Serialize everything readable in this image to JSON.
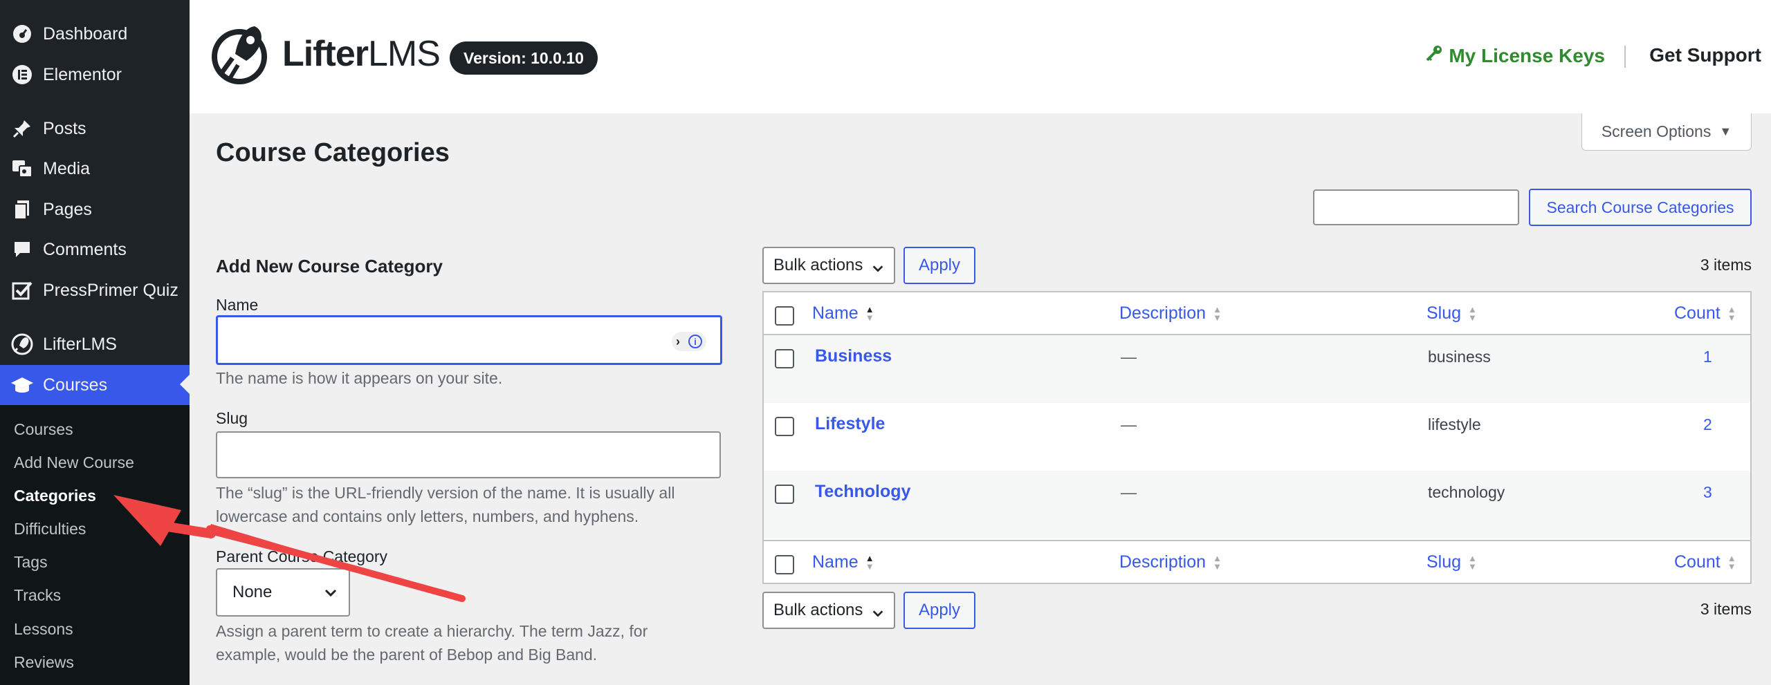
{
  "sidebar": {
    "items": [
      {
        "label": "Dashboard",
        "icon": "dashboard-icon"
      },
      {
        "label": "Elementor",
        "icon": "elementor-icon"
      },
      {
        "label": "Posts",
        "icon": "pin-icon"
      },
      {
        "label": "Media",
        "icon": "media-icon"
      },
      {
        "label": "Pages",
        "icon": "pages-icon"
      },
      {
        "label": "Comments",
        "icon": "comment-icon"
      },
      {
        "label": "PressPrimer Quiz",
        "icon": "checkbox-icon"
      },
      {
        "label": "LifterLMS",
        "icon": "rocket-icon"
      },
      {
        "label": "Courses",
        "icon": "graduation-cap-icon",
        "active": true
      }
    ],
    "submenu": [
      "Courses",
      "Add New Course",
      "Categories",
      "Difficulties",
      "Tags",
      "Tracks",
      "Lessons",
      "Reviews"
    ],
    "current_submenu": "Categories",
    "accent_color": "#3858e9"
  },
  "header": {
    "logo_text_bold": "Lifter",
    "logo_text_light": "LMS",
    "version": "Version: 10.0.10",
    "license_link": "My License Keys",
    "support_link": "Get Support",
    "license_color": "#2e8b2e"
  },
  "screen_options": {
    "label": "Screen Options"
  },
  "page_title": "Course Categories",
  "search": {
    "button_label": "Search Course Categories",
    "value": ""
  },
  "form": {
    "title": "Add New Course Category",
    "name_label": "Name",
    "name_value": "",
    "name_desc": "The name is how it appears on your site.",
    "slug_label": "Slug",
    "slug_value": "",
    "slug_desc": "The “slug” is the URL-friendly version of the name. It is usually all lowercase and contains only letters, numbers, and hyphens.",
    "parent_label": "Parent Course Category",
    "parent_value": "None",
    "parent_desc": "Assign a parent term to create a hierarchy. The term Jazz, for example, would be the parent of Bebop and Big Band."
  },
  "tablenav": {
    "bulk_label": "Bulk actions",
    "apply_label": "Apply",
    "items_count": "3 items"
  },
  "table": {
    "columns": [
      "Name",
      "Description",
      "Slug",
      "Count"
    ],
    "rows": [
      {
        "name": "Business",
        "description": "—",
        "slug": "business",
        "count": "1"
      },
      {
        "name": "Lifestyle",
        "description": "—",
        "slug": "lifestyle",
        "count": "2"
      },
      {
        "name": "Technology",
        "description": "—",
        "slug": "technology",
        "count": "3"
      }
    ]
  },
  "annotation": {
    "color": "#ef4444"
  }
}
